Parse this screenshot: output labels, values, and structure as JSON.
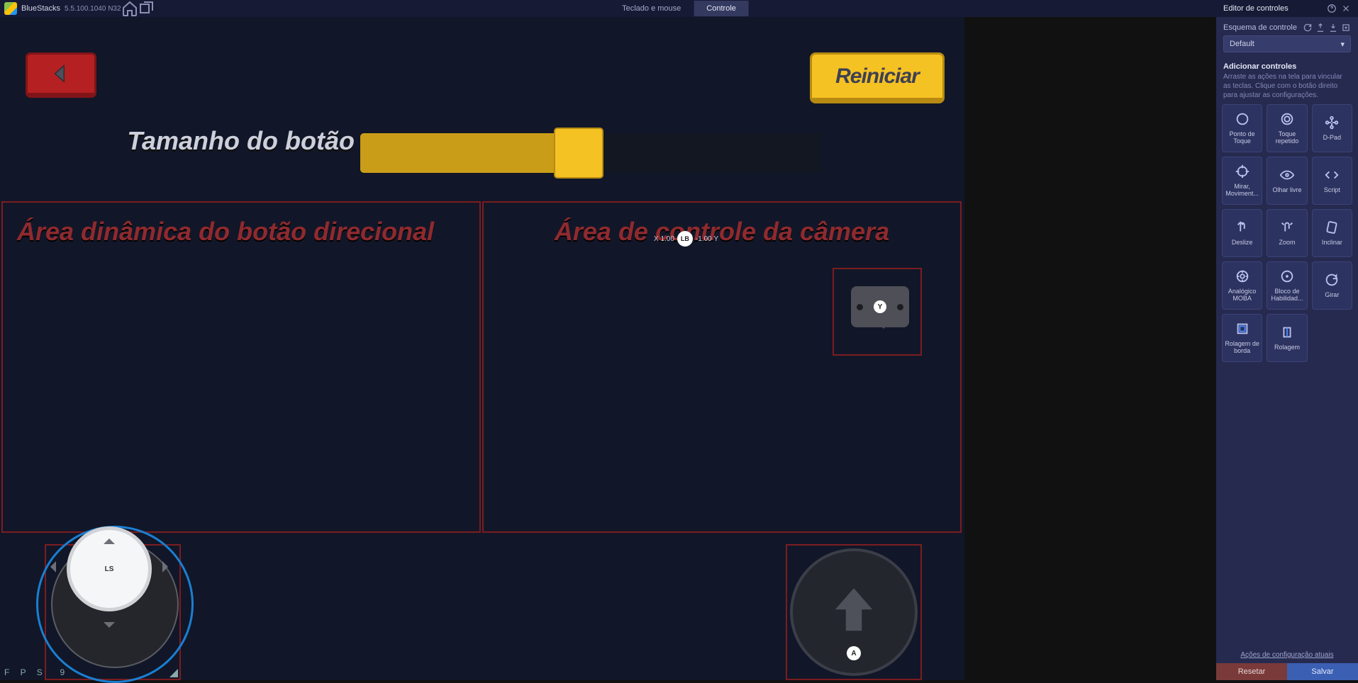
{
  "topbar": {
    "app_name": "BlueStacks",
    "version": "5.5.100.1040 N32",
    "tabs": {
      "keyboard": "Teclado e mouse",
      "gamepad": "Controle"
    }
  },
  "game": {
    "back_label": "Voltar",
    "restart_label": "Reiniciar",
    "slider_label": "Tamanho do botão",
    "zone_left_title": "Área dinâmica do botão direcional",
    "zone_right_title": "Área de controle da câmera",
    "joystick_key": "LS",
    "chat_key": "Y",
    "jump_key": "A",
    "freelook": {
      "x_label": "X",
      "x_val": "1.00",
      "key": "LB",
      "y_val": "-1.00",
      "y_label": "Y"
    },
    "fps_label": "F P S",
    "fps_value": "9"
  },
  "panel": {
    "title": "Editor de controles",
    "scheme_label": "Esquema de controle",
    "scheme_value": "Default",
    "add_title": "Adicionar controles",
    "add_hint": "Arraste as ações na tela para vincular as teclas. Clique com o botão direito para ajustar as configurações.",
    "controls": [
      "Ponto de Toque",
      "Toque repetido",
      "D-Pad",
      "Mirar, Moviment...",
      "Olhar livre",
      "Script",
      "Deslize",
      "Zoom",
      "Inclinar",
      "Analógico MOBA",
      "Bloco de Habilidad...",
      "Girar",
      "Rolagem de borda",
      "Rolagem"
    ],
    "footer_link": "Ações de configuração atuais",
    "reset": "Resetar",
    "save": "Salvar"
  }
}
